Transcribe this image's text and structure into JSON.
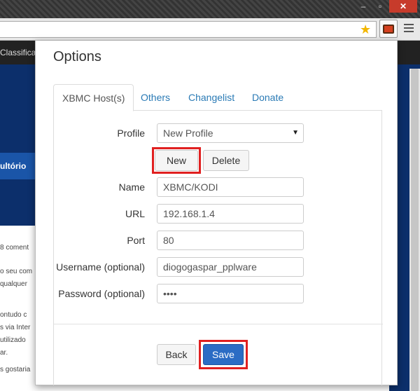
{
  "background_page": {
    "nav_text": "Classifica",
    "tab_text": "ultório",
    "comments": "8 coment",
    "lines": [
      "o seu com",
      "qualquer",
      "ontudo c",
      "s via Inter",
      "utilizado",
      "ar.",
      "s gostaria"
    ]
  },
  "dialog": {
    "title": "Options",
    "tabs": [
      "XBMC Host(s)",
      "Others",
      "Changelist",
      "Donate"
    ],
    "fields": {
      "profile_label": "Profile",
      "profile_value": "New Profile",
      "name_label": "Name",
      "name_value": "XBMC/KODI",
      "url_label": "URL",
      "url_value": "192.168.1.4",
      "port_label": "Port",
      "port_value": "80",
      "username_label": "Username (optional)",
      "username_value": "diogogaspar_pplware",
      "password_label": "Password (optional)",
      "password_value": "••••"
    },
    "buttons": {
      "new": "New",
      "delete": "Delete",
      "back": "Back",
      "save": "Save"
    }
  },
  "colors": {
    "highlight": "#e02020",
    "primary_button": "#2b6cc4",
    "link": "#2a7ab5"
  }
}
